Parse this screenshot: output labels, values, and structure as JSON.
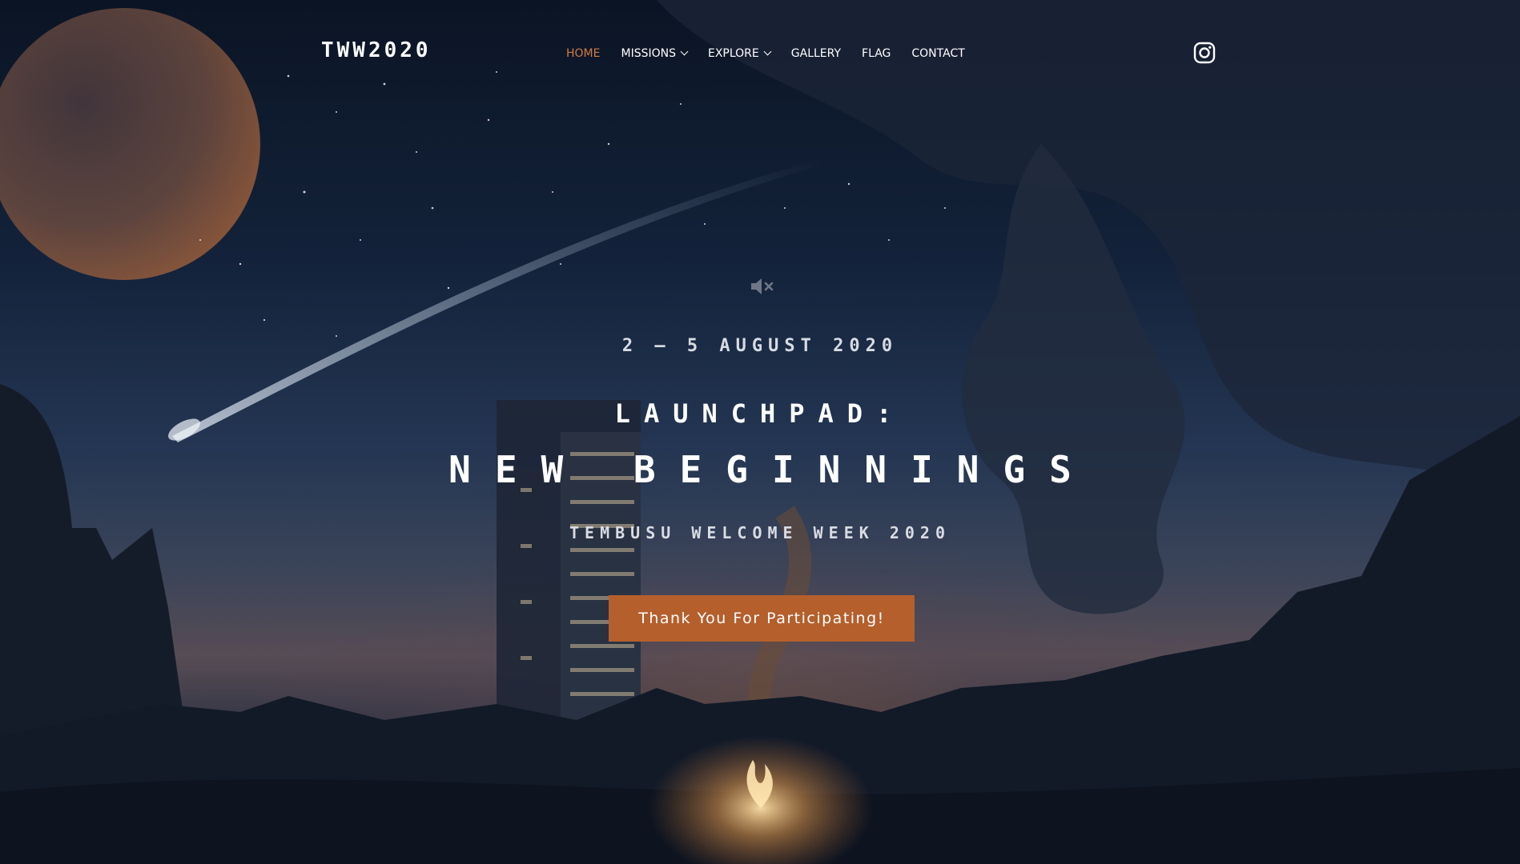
{
  "header": {
    "logo": "TWW2020",
    "nav": [
      {
        "label": "HOME",
        "active": true,
        "dropdown": false
      },
      {
        "label": "MISSIONS",
        "active": false,
        "dropdown": true
      },
      {
        "label": "EXPLORE",
        "active": false,
        "dropdown": true
      },
      {
        "label": "GALLERY",
        "active": false,
        "dropdown": false
      },
      {
        "label": "FLAG",
        "active": false,
        "dropdown": false
      },
      {
        "label": "CONTACT",
        "active": false,
        "dropdown": false
      }
    ],
    "social_icon": "instagram-icon"
  },
  "hero": {
    "mute_icon": "volume-mute-icon",
    "dates": "2 – 5 AUGUST 2020",
    "title_line1": "LAUNCHPAD:",
    "title_line2": "NEW BEGINNINGS",
    "subtitle": "TEMBUSU WELCOME WEEK 2020",
    "cta_label": "Thank You For Participating!"
  },
  "colors": {
    "accent": "#b55f2c",
    "nav_active": "#d27a42",
    "background": "#0c1627",
    "text": "#ffffff"
  }
}
